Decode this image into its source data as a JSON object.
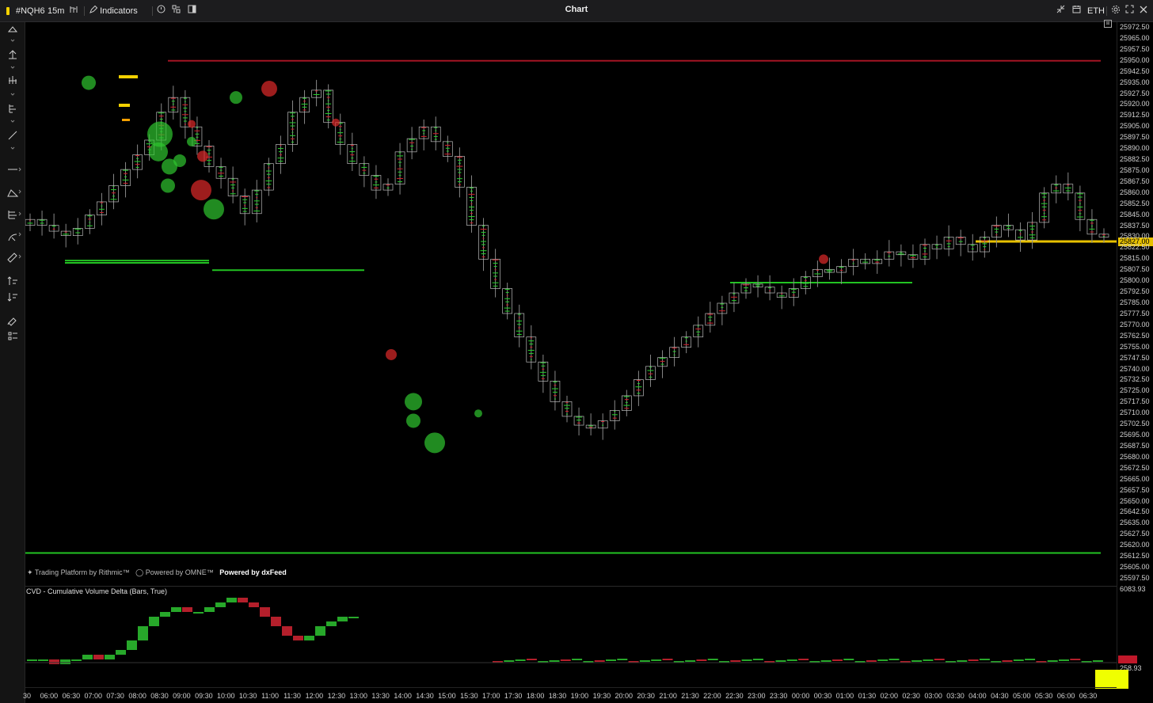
{
  "toolbar": {
    "symbol": "#NQH6",
    "interval": "15m",
    "indicators_label": "Indicators",
    "title": "Chart",
    "session": "ETH"
  },
  "left_tools": [
    "triangle-icon",
    "arrow-up-icon",
    "bars-icon",
    "columns-icon",
    "line-icon",
    "hline-icon",
    "shape-icon",
    "fib-icon",
    "pitchfork-icon",
    "ruler-icon",
    "sort-asc-icon",
    "sort-desc-icon",
    "brush-icon",
    "list-icon"
  ],
  "price_axis": {
    "labels": [
      "25972.50",
      "25965.00",
      "25957.50",
      "25950.00",
      "25942.50",
      "25935.00",
      "25927.50",
      "25920.00",
      "25912.50",
      "25905.00",
      "25897.50",
      "25890.00",
      "25882.50",
      "25875.00",
      "25867.50",
      "25860.00",
      "25852.50",
      "25845.00",
      "25837.50",
      "25830.00",
      "25822.50",
      "25815.00",
      "25807.50",
      "25800.00",
      "25792.50",
      "25785.00",
      "25777.50",
      "25770.00",
      "25762.50",
      "25755.00",
      "25747.50",
      "25740.00",
      "25732.50",
      "25725.00",
      "25717.50",
      "25710.00",
      "25702.50",
      "25695.00",
      "25687.50",
      "25680.00",
      "25672.50",
      "25665.00",
      "25657.50",
      "25650.00",
      "25642.50",
      "25635.00",
      "25627.50",
      "25620.00",
      "25612.50",
      "25605.00",
      "25597.50"
    ],
    "current_price": "25827.00"
  },
  "time_axis": [
    "30",
    "06:00",
    "06:30",
    "07:00",
    "07:30",
    "08:00",
    "08:30",
    "09:00",
    "09:30",
    "10:00",
    "10:30",
    "11:00",
    "11:30",
    "12:00",
    "12:30",
    "13:00",
    "13:30",
    "14:00",
    "14:30",
    "15:00",
    "15:30",
    "17:00",
    "17:30",
    "18:00",
    "18:30",
    "19:00",
    "19:30",
    "20:00",
    "20:30",
    "21:00",
    "21:30",
    "22:00",
    "22:30",
    "23:00",
    "23:30",
    "00:00",
    "00:30",
    "01:00",
    "01:30",
    "02:00",
    "02:30",
    "03:00",
    "03:30",
    "04:00",
    "04:30",
    "05:00",
    "05:30",
    "06:00",
    "06:30"
  ],
  "watermark": {
    "rithmic": "Trading Platform by Rithmic™",
    "omne": "Powered by OMNE™",
    "dxfeed": "Powered by dxFeed"
  },
  "cvd": {
    "title": "CVD - Cumulative Volume Delta (Bars, True)",
    "top_value": "6083.93",
    "bottom_value": "258.93",
    "marker": "0"
  },
  "chart_data": {
    "type": "candlestick",
    "symbol": "#NQH6",
    "interval": "15m",
    "ylim": [
      25597.5,
      25972.5
    ],
    "levels": [
      {
        "price": 25950.0,
        "color": "#c0182a"
      },
      {
        "price": 25814.0,
        "color": "#22c322"
      },
      {
        "price": 25812.5,
        "color": "#22c322"
      },
      {
        "price": 25807.5,
        "color": "#22c322"
      },
      {
        "price": 25799.0,
        "color": "#22c322"
      },
      {
        "price": 25615.0,
        "color": "#22c322"
      },
      {
        "price": 25827.0,
        "color": "#e8c100"
      }
    ],
    "closes": [
      25842,
      25838,
      25834,
      25831,
      25836,
      25845,
      25854,
      25865,
      25876,
      25886,
      25896,
      25915,
      25925,
      25905,
      25892,
      25878,
      25870,
      25858,
      25846,
      25862,
      25880,
      25893,
      25915,
      25925,
      25930,
      25908,
      25893,
      25880,
      25872,
      25862,
      25866,
      25888,
      25897,
      25905,
      25895,
      25885,
      25864,
      25838,
      25815,
      25795,
      25778,
      25762,
      25745,
      25732,
      25718,
      25708,
      25702,
      25700,
      25705,
      25712,
      25722,
      25733,
      25742,
      25748,
      25755,
      25762,
      25770,
      25778,
      25785,
      25792,
      25798,
      25796,
      25792,
      25789,
      25795,
      25803,
      25808,
      25806,
      25810,
      25815,
      25812,
      25815,
      25820,
      25818,
      25815,
      25825,
      25822,
      25830,
      25825,
      25820,
      25830,
      25838,
      25835,
      25828,
      25840,
      25860,
      25866,
      25860,
      25842,
      25832,
      25830
    ]
  }
}
